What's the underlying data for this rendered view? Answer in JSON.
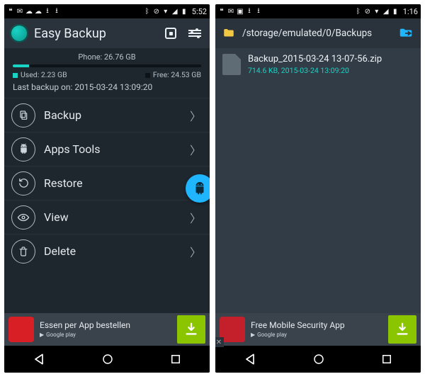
{
  "left": {
    "status": {
      "time": "5:52"
    },
    "app_title": "Easy Backup",
    "storage": {
      "phone_label": "Phone: 26.76 GB",
      "used_label": "Used: 2.23 GB",
      "free_label": "Free: 24.53 GB",
      "used_pct": 8.3
    },
    "last_backup": "Last backup on: 2015-03-24 13:09:20",
    "menu": {
      "backup": "Backup",
      "apps_tools": "Apps Tools",
      "restore": "Restore",
      "view": "View",
      "delete": "Delete"
    },
    "ad": {
      "title": "Essen per App bestellen",
      "store": "Google play",
      "thumb_color": "#d91f26"
    }
  },
  "right": {
    "status": {
      "time": "1:16"
    },
    "path": "/storage/emulated/0/Backups",
    "file": {
      "name": "Backup_2015-03-24 13-07-56.zip",
      "meta": "714.6 KB, 2015-03-24 13:09:20"
    },
    "ad": {
      "title": "Free Mobile Security App",
      "store": "Google play",
      "thumb_color": "#c4202c"
    }
  },
  "icons": {
    "backup": "backup-icon",
    "apps": "android-icon",
    "restore": "restore-icon",
    "view": "eye-icon",
    "delete": "trash-icon"
  }
}
